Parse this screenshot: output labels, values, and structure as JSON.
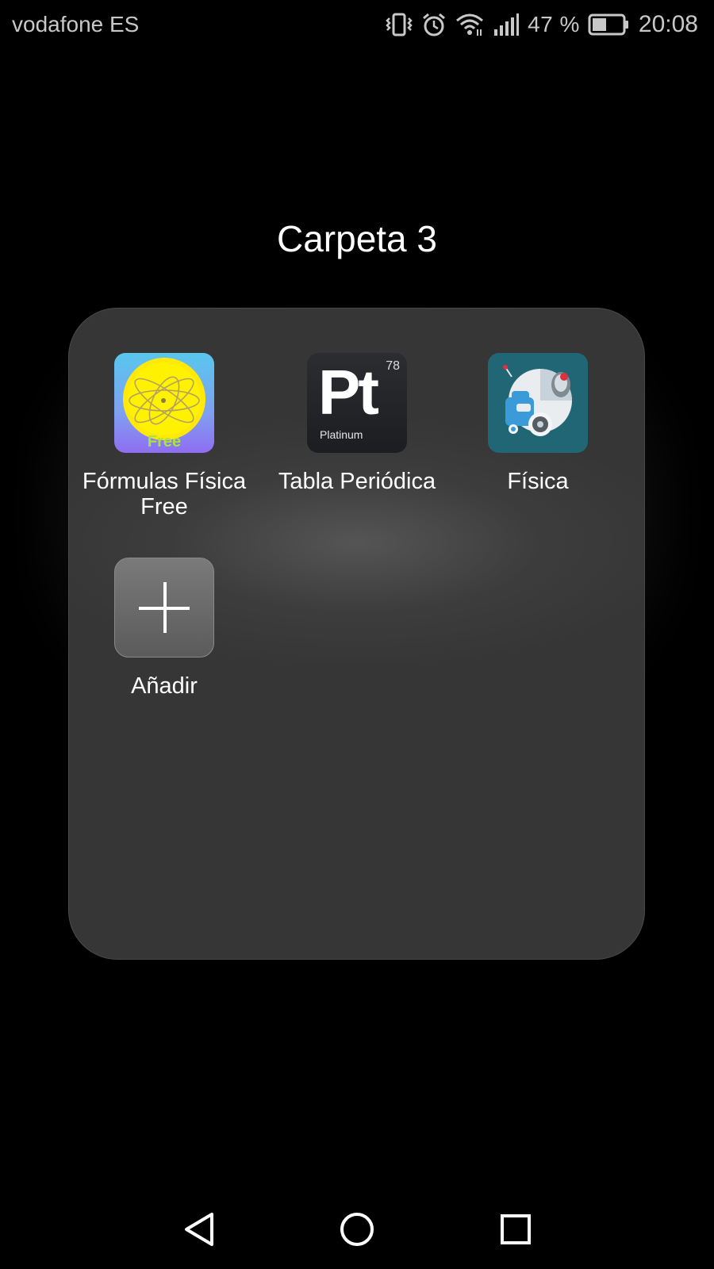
{
  "status_bar": {
    "carrier": "vodafone ES",
    "battery_percent": "47 %",
    "battery_level": 0.47,
    "time": "20:08",
    "icons": [
      "vibrate-icon",
      "alarm-icon",
      "wifi-icon",
      "signal-icon",
      "battery-icon"
    ]
  },
  "folder": {
    "title": "Carpeta 3",
    "apps": [
      {
        "label": "Fórmulas Física\nFree",
        "icon": "atom-free-icon",
        "badge": "Free"
      },
      {
        "label": "Tabla Periódica",
        "icon": "platinum-element-icon",
        "symbol": "Pt",
        "number": "78",
        "element_name": "Platinum"
      },
      {
        "label": "Física",
        "icon": "robot-icon"
      }
    ],
    "add": {
      "label": "Añadir",
      "icon": "plus-icon"
    }
  },
  "nav_bar": {
    "buttons": [
      "back",
      "home",
      "recents"
    ]
  },
  "colors": {
    "background": "#000000",
    "panel": "#363636",
    "text": "#ffffff",
    "status_text": "#c8c8c8"
  }
}
